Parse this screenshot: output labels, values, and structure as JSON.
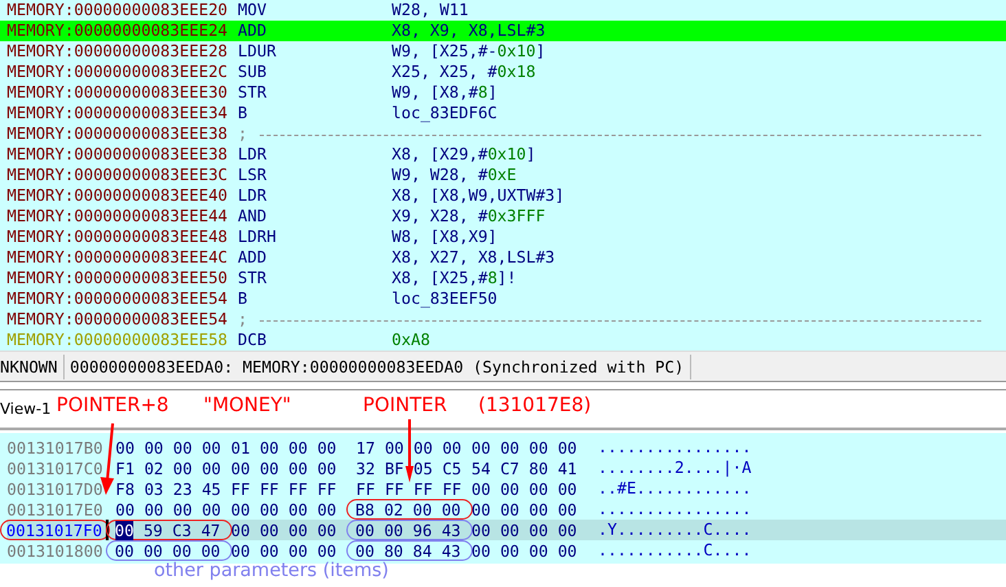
{
  "disassembly": {
    "lines": [
      {
        "kind": "code",
        "selected": false,
        "address": "MEMORY:00000000083EEE20",
        "mnemonic": "MOV",
        "operands": [
          {
            "kind": "reg",
            "text": "W28, W11"
          }
        ]
      },
      {
        "kind": "code",
        "selected": true,
        "address": "MEMORY:00000000083EEE24",
        "mnemonic": "ADD",
        "operands": [
          {
            "kind": "reg",
            "text": "X8, X9, X8,LSL#3"
          }
        ]
      },
      {
        "kind": "code",
        "selected": false,
        "address": "MEMORY:00000000083EEE28",
        "mnemonic": "LDUR",
        "operands": [
          {
            "kind": "reg",
            "text": "W9, [X25,#-"
          },
          {
            "kind": "num",
            "text": "0x10"
          },
          {
            "kind": "reg",
            "text": "]"
          }
        ]
      },
      {
        "kind": "code",
        "selected": false,
        "address": "MEMORY:00000000083EEE2C",
        "mnemonic": "SUB",
        "operands": [
          {
            "kind": "reg",
            "text": "X25, X25, #"
          },
          {
            "kind": "num",
            "text": "0x18"
          }
        ]
      },
      {
        "kind": "code",
        "selected": false,
        "address": "MEMORY:00000000083EEE30",
        "mnemonic": "STR",
        "operands": [
          {
            "kind": "reg",
            "text": "W9, [X8,#"
          },
          {
            "kind": "num",
            "text": "8"
          },
          {
            "kind": "reg",
            "text": "]"
          }
        ]
      },
      {
        "kind": "code",
        "selected": false,
        "address": "MEMORY:00000000083EEE34",
        "mnemonic": "B",
        "operands": [
          {
            "kind": "reg",
            "text": "loc_83EDF6C"
          }
        ]
      },
      {
        "kind": "separator",
        "selected": false,
        "address": "MEMORY:00000000083EEE38",
        "mnemonic": ";"
      },
      {
        "kind": "code",
        "selected": false,
        "address": "MEMORY:00000000083EEE38",
        "mnemonic": "LDR",
        "operands": [
          {
            "kind": "reg",
            "text": "X8, [X29,#"
          },
          {
            "kind": "num",
            "text": "0x10"
          },
          {
            "kind": "reg",
            "text": "]"
          }
        ]
      },
      {
        "kind": "code",
        "selected": false,
        "address": "MEMORY:00000000083EEE3C",
        "mnemonic": "LSR",
        "operands": [
          {
            "kind": "reg",
            "text": "W9, W28, #"
          },
          {
            "kind": "num",
            "text": "0xE"
          }
        ]
      },
      {
        "kind": "code",
        "selected": false,
        "address": "MEMORY:00000000083EEE40",
        "mnemonic": "LDR",
        "operands": [
          {
            "kind": "reg",
            "text": "X8, [X8,W9,UXTW#3]"
          }
        ]
      },
      {
        "kind": "code",
        "selected": false,
        "address": "MEMORY:00000000083EEE44",
        "mnemonic": "AND",
        "operands": [
          {
            "kind": "reg",
            "text": "X9, X28, #"
          },
          {
            "kind": "num",
            "text": "0x3FFF"
          }
        ]
      },
      {
        "kind": "code",
        "selected": false,
        "address": "MEMORY:00000000083EEE48",
        "mnemonic": "LDRH",
        "operands": [
          {
            "kind": "reg",
            "text": "W8, [X8,X9]"
          }
        ]
      },
      {
        "kind": "code",
        "selected": false,
        "address": "MEMORY:00000000083EEE4C",
        "mnemonic": "ADD",
        "operands": [
          {
            "kind": "reg",
            "text": "X8, X27, X8,LSL#3"
          }
        ]
      },
      {
        "kind": "code",
        "selected": false,
        "address": "MEMORY:00000000083EEE50",
        "mnemonic": "STR",
        "operands": [
          {
            "kind": "reg",
            "text": "X8, [X25,#"
          },
          {
            "kind": "num",
            "text": "8"
          },
          {
            "kind": "reg",
            "text": "]!"
          }
        ]
      },
      {
        "kind": "code",
        "selected": false,
        "address": "MEMORY:00000000083EEE54",
        "mnemonic": "B",
        "operands": [
          {
            "kind": "reg",
            "text": "loc_83EEF50"
          }
        ]
      },
      {
        "kind": "separator",
        "selected": false,
        "address": "MEMORY:00000000083EEE54",
        "mnemonic": ";"
      },
      {
        "kind": "data",
        "selected": false,
        "address": "MEMORY:00000000083EEE58",
        "mnemonic": "DCB",
        "operands": [
          {
            "kind": "num",
            "text": "0xA8"
          }
        ]
      }
    ]
  },
  "status_bar": [
    "NKNOWN",
    "00000000083EEDA0: MEMORY:00000000083EEDA0 (Synchronized with PC)"
  ],
  "hex_view": {
    "tab": "View-1",
    "rows": [
      {
        "address": {
          "text": "00131017B0"
        },
        "selected": false,
        "cursor": false,
        "groups": [
          {
            "text": "00 00 00 00"
          },
          {
            "text": "01 00 00 00"
          },
          {
            "text": "17 00 00 00"
          },
          {
            "text": "00 00 00 00"
          }
        ],
        "ascii": "................"
      },
      {
        "address": {
          "text": "00131017C0"
        },
        "selected": false,
        "cursor": false,
        "groups": [
          {
            "text": "F1 02 00 00"
          },
          {
            "text": "00 00 00 00"
          },
          {
            "text": "32 BF 05 C5"
          },
          {
            "text": "54 C7 80 41"
          }
        ],
        "ascii": "........2....|·A"
      },
      {
        "address": {
          "text": "00131017D0"
        },
        "selected": false,
        "cursor": false,
        "groups": [
          {
            "text": "F8 03 23 45"
          },
          {
            "text": "FF FF FF FF"
          },
          {
            "text": "FF FF FF FF"
          },
          {
            "text": "00 00 00 00"
          }
        ],
        "ascii": "..#E............"
      },
      {
        "address": {
          "text": "00131017E0"
        },
        "selected": false,
        "cursor": false,
        "groups": [
          {
            "text": "00 00 00 00"
          },
          {
            "text": "00 00 00 00"
          },
          {
            "text": "B8 02 00 00",
            "color": "#ee2222"
          },
          {
            "text": "00 00 00 00"
          }
        ],
        "ascii": "................"
      },
      {
        "address": {
          "text": "00131017F0",
          "color": "#ee2222"
        },
        "selected": true,
        "cursor": true,
        "groups": [
          {
            "text": "00 59 C3 47",
            "color": "#ee2222"
          },
          {
            "text": "00 00 00 00"
          },
          {
            "text": "00 00 96 43",
            "color": "#8080ee"
          },
          {
            "text": "00 00 00 00"
          }
        ],
        "ascii": ".Y.........C...."
      },
      {
        "address": {
          "text": "0013101800"
        },
        "selected": false,
        "cursor": false,
        "groups": [
          {
            "text": "00 00 00 00",
            "color": "#8080ee"
          },
          {
            "text": "00 00 00 00"
          },
          {
            "text": "00 80 84 43",
            "color": "#8080ee"
          },
          {
            "text": "00 00 00 00"
          }
        ],
        "ascii": "...........C...."
      }
    ]
  },
  "annotations": {
    "labels": [
      "POINTER+8",
      "\"MONEY\"",
      "POINTER",
      "(131017E8)"
    ],
    "note": "other parameters (items)"
  }
}
